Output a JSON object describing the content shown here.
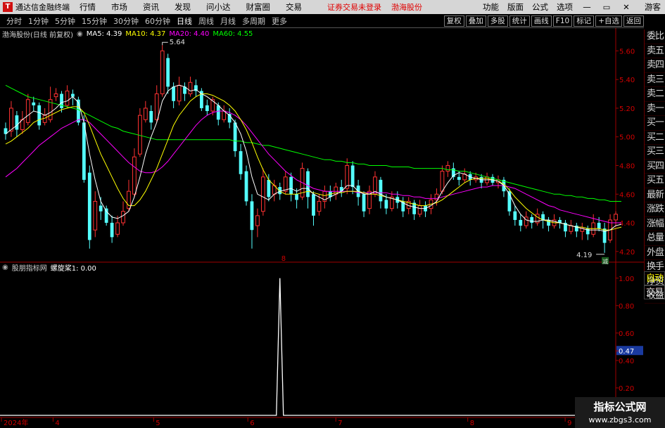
{
  "app": {
    "name": "通达信金融终端",
    "menus": [
      "行情",
      "市场",
      "资讯",
      "发现",
      "问小达",
      "财富圈",
      "交易"
    ],
    "login_status": "证券交易未登录",
    "current_stock": "渤海股份",
    "right_menus": [
      "功能",
      "版面",
      "公式",
      "选项"
    ],
    "user": "游客"
  },
  "toolbar": {
    "periods": [
      "分时",
      "1分钟",
      "5分钟",
      "15分钟",
      "30分钟",
      "60分钟",
      "日线",
      "周线",
      "月线",
      "多周期",
      "更多"
    ],
    "active_period": "日线",
    "tools": [
      "复权",
      "叠加",
      "多股",
      "统计",
      "画线",
      "F10",
      "标记",
      "+自选",
      "返回"
    ]
  },
  "chart_header": {
    "stock_label": "渤海股份(日线 前复权)",
    "ma5": "MA5: 4.39",
    "ma10": "MA10: 4.37",
    "ma20": "MA20: 4.40",
    "ma60": "MA60: 4.55"
  },
  "indicator_header": {
    "name": "股朋指标网",
    "value_label": "螺旋桨1: 0.00"
  },
  "sidebar": {
    "items": [
      "委比",
      "卖五",
      "卖四",
      "卖三",
      "卖二",
      "卖一",
      "买一",
      "买二",
      "买三",
      "买四",
      "买五",
      "最新",
      "涨跌",
      "涨幅",
      "总量",
      "外盘",
      "换手",
      "净资",
      "收益"
    ],
    "bottom_items": [
      "自动",
      "交易"
    ]
  },
  "annotations": {
    "high_label": "5.64",
    "low_label": "4.19",
    "mid_marker": "8",
    "small_badge": "减"
  },
  "price_axis": [
    "5.60",
    "5.40",
    "5.20",
    "5.00",
    "4.80",
    "4.60",
    "4.40",
    "4.20"
  ],
  "indicator_axis": [
    "1.00",
    "0.80",
    "0.60",
    "0.47",
    "0.40",
    "0.20"
  ],
  "date_axis": [
    "2024年",
    "4",
    "5",
    "6",
    "7",
    "8",
    "9"
  ],
  "watermark": {
    "title": "指标公式网",
    "url": "www.zbgs3.com"
  },
  "colors": {
    "up": "#54ffff",
    "down": "#ff3232",
    "ma5": "#ffffff",
    "ma10": "#ffff00",
    "ma20": "#ff00ff",
    "ma60": "#00ff00",
    "signal": "#ffffff",
    "axis": "#a00000"
  },
  "chart_data": {
    "type": "candlestick",
    "price_range": [
      4.15,
      5.7
    ],
    "indicator": {
      "name": "螺旋桨1",
      "values_note": "single spike to 1.00",
      "range": [
        0,
        1.05
      ],
      "current_value": 0.47
    },
    "candles": [
      [
        5.06,
        5.02,
        5.1,
        4.98
      ],
      [
        5.04,
        5.2,
        5.25,
        5.0
      ],
      [
        5.15,
        5.05,
        5.18,
        5.0
      ],
      [
        5.05,
        5.12,
        5.18,
        5.02
      ],
      [
        5.1,
        5.26,
        5.3,
        5.08
      ],
      [
        5.24,
        5.22,
        5.28,
        5.18
      ],
      [
        5.22,
        5.08,
        5.24,
        5.05
      ],
      [
        5.1,
        5.15,
        5.2,
        5.08
      ],
      [
        5.12,
        5.26,
        5.35,
        5.1
      ],
      [
        5.28,
        5.3,
        5.34,
        5.25
      ],
      [
        5.3,
        5.2,
        5.32,
        5.17
      ],
      [
        5.22,
        5.32,
        5.36,
        5.2
      ],
      [
        5.3,
        5.28,
        5.33,
        5.22
      ],
      [
        5.26,
        5.1,
        5.28,
        5.08
      ],
      [
        5.1,
        4.7,
        5.15,
        4.68
      ],
      [
        4.75,
        4.28,
        4.8,
        4.22
      ],
      [
        4.35,
        4.55,
        4.62,
        4.3
      ],
      [
        4.52,
        4.48,
        4.58,
        4.42
      ],
      [
        4.5,
        4.4,
        4.52,
        4.38
      ],
      [
        4.4,
        4.3,
        4.45,
        4.26
      ],
      [
        4.32,
        4.4,
        4.45,
        4.3
      ],
      [
        4.4,
        4.48,
        4.55,
        4.38
      ],
      [
        4.5,
        4.62,
        4.7,
        4.48
      ],
      [
        4.6,
        4.86,
        4.92,
        4.58
      ],
      [
        4.88,
        5.15,
        5.2,
        4.86
      ],
      [
        5.12,
        5.2,
        5.25,
        5.1
      ],
      [
        5.18,
        5.1,
        5.22,
        5.05
      ],
      [
        5.12,
        5.3,
        5.36,
        5.1
      ],
      [
        5.3,
        5.6,
        5.64,
        5.28
      ],
      [
        5.55,
        5.35,
        5.58,
        5.3
      ],
      [
        5.35,
        5.25,
        5.38,
        5.2
      ],
      [
        5.25,
        5.36,
        5.42,
        5.22
      ],
      [
        5.35,
        5.3,
        5.38,
        5.25
      ],
      [
        5.3,
        5.38,
        5.42,
        5.28
      ],
      [
        5.36,
        5.32,
        5.4,
        5.28
      ],
      [
        5.32,
        5.2,
        5.34,
        5.18
      ],
      [
        5.22,
        5.18,
        5.26,
        5.15
      ],
      [
        5.18,
        5.26,
        5.28,
        5.15
      ],
      [
        5.22,
        5.12,
        5.24,
        5.08
      ],
      [
        5.12,
        5.18,
        5.22,
        5.1
      ],
      [
        5.16,
        5.1,
        5.2,
        5.06
      ],
      [
        5.1,
        4.9,
        5.12,
        4.86
      ],
      [
        4.9,
        4.74,
        4.95,
        4.7
      ],
      [
        4.76,
        4.55,
        4.8,
        4.52
      ],
      [
        4.55,
        4.35,
        4.6,
        4.22
      ],
      [
        4.38,
        4.45,
        4.5,
        4.3
      ],
      [
        4.48,
        4.72,
        4.78,
        4.45
      ],
      [
        4.7,
        4.58,
        4.74,
        4.55
      ],
      [
        4.6,
        4.66,
        4.7,
        4.55
      ],
      [
        4.65,
        4.6,
        4.68,
        4.56
      ],
      [
        4.62,
        4.72,
        4.76,
        4.6
      ],
      [
        4.72,
        4.6,
        4.75,
        4.55
      ],
      [
        4.6,
        4.56,
        4.64,
        4.5
      ],
      [
        4.58,
        4.78,
        4.82,
        4.56
      ],
      [
        4.76,
        4.58,
        4.78,
        4.5
      ],
      [
        4.6,
        4.45,
        4.62,
        4.38
      ],
      [
        4.48,
        4.55,
        4.6,
        4.45
      ],
      [
        4.55,
        4.62,
        4.66,
        4.5
      ],
      [
        4.62,
        4.58,
        4.66,
        4.55
      ],
      [
        4.6,
        4.65,
        4.68,
        4.56
      ],
      [
        4.65,
        4.62,
        4.7,
        4.58
      ],
      [
        4.64,
        4.8,
        4.85,
        4.6
      ],
      [
        4.8,
        4.65,
        4.83,
        4.6
      ],
      [
        4.66,
        4.58,
        4.7,
        4.52
      ],
      [
        4.6,
        4.48,
        4.62,
        4.44
      ],
      [
        4.5,
        4.62,
        4.66,
        4.46
      ],
      [
        4.6,
        4.72,
        4.76,
        4.58
      ],
      [
        4.7,
        4.55,
        4.72,
        4.5
      ],
      [
        4.56,
        4.5,
        4.6,
        4.46
      ],
      [
        4.5,
        4.58,
        4.62,
        4.48
      ],
      [
        4.58,
        4.54,
        4.62,
        4.5
      ],
      [
        4.55,
        4.48,
        4.58,
        4.44
      ],
      [
        4.5,
        4.55,
        4.58,
        4.46
      ],
      [
        4.54,
        4.46,
        4.56,
        4.42
      ],
      [
        4.46,
        4.52,
        4.56,
        4.44
      ],
      [
        4.52,
        4.48,
        4.55,
        4.44
      ],
      [
        4.5,
        4.56,
        4.6,
        4.46
      ],
      [
        4.56,
        4.6,
        4.64,
        4.52
      ],
      [
        4.62,
        4.76,
        4.8,
        4.6
      ],
      [
        4.76,
        4.8,
        4.83,
        4.72
      ],
      [
        4.78,
        4.72,
        4.82,
        4.7
      ],
      [
        4.72,
        4.7,
        4.76,
        4.66
      ],
      [
        4.7,
        4.74,
        4.78,
        4.68
      ],
      [
        4.74,
        4.7,
        4.76,
        4.66
      ],
      [
        4.7,
        4.72,
        4.75,
        4.68
      ],
      [
        4.72,
        4.68,
        4.74,
        4.64
      ],
      [
        4.68,
        4.72,
        4.75,
        4.66
      ],
      [
        4.72,
        4.68,
        4.74,
        4.66
      ],
      [
        4.68,
        4.7,
        4.73,
        4.64
      ],
      [
        4.7,
        4.62,
        4.72,
        4.58
      ],
      [
        4.62,
        4.48,
        4.64,
        4.45
      ],
      [
        4.48,
        4.42,
        4.52,
        4.38
      ],
      [
        4.42,
        4.38,
        4.46,
        4.34
      ],
      [
        4.38,
        4.44,
        4.48,
        4.36
      ],
      [
        4.44,
        4.4,
        4.46,
        4.36
      ],
      [
        4.4,
        4.46,
        4.5,
        4.38
      ],
      [
        4.46,
        4.42,
        4.48,
        4.36
      ],
      [
        4.42,
        4.38,
        4.44,
        4.34
      ],
      [
        4.38,
        4.42,
        4.46,
        4.36
      ],
      [
        4.42,
        4.4,
        4.44,
        4.36
      ],
      [
        4.4,
        4.34,
        4.42,
        4.3
      ],
      [
        4.34,
        4.38,
        4.42,
        4.32
      ],
      [
        4.38,
        4.34,
        4.4,
        4.3
      ],
      [
        4.34,
        4.36,
        4.4,
        4.28
      ],
      [
        4.36,
        4.32,
        4.38,
        4.28
      ],
      [
        4.32,
        4.4,
        4.46,
        4.3
      ],
      [
        4.4,
        4.36,
        4.44,
        4.34
      ],
      [
        4.36,
        4.26,
        4.4,
        4.19
      ],
      [
        4.28,
        4.42,
        4.46,
        4.26
      ],
      [
        4.42,
        4.46,
        4.48,
        4.38
      ]
    ],
    "ma5": [
      5.02,
      5.05,
      5.08,
      5.12,
      5.15,
      5.18,
      5.17,
      5.15,
      5.17,
      5.2,
      5.24,
      5.25,
      5.28,
      5.24,
      5.1,
      4.88,
      4.7,
      4.55,
      4.48,
      4.44,
      4.43,
      4.45,
      4.48,
      4.58,
      4.72,
      4.88,
      5.0,
      5.1,
      5.25,
      5.32,
      5.35,
      5.36,
      5.35,
      5.32,
      5.33,
      5.3,
      5.28,
      5.25,
      5.22,
      5.18,
      5.15,
      5.1,
      5.02,
      4.9,
      4.72,
      4.6,
      4.58,
      4.56,
      4.6,
      4.62,
      4.63,
      4.64,
      4.62,
      4.64,
      4.64,
      4.6,
      4.58,
      4.56,
      4.58,
      4.6,
      4.62,
      4.66,
      4.66,
      4.62,
      4.6,
      4.6,
      4.62,
      4.6,
      4.58,
      4.57,
      4.56,
      4.54,
      4.52,
      4.51,
      4.5,
      4.5,
      4.52,
      4.55,
      4.62,
      4.68,
      4.73,
      4.75,
      4.74,
      4.72,
      4.71,
      4.7,
      4.7,
      4.7,
      4.69,
      4.66,
      4.6,
      4.52,
      4.46,
      4.42,
      4.41,
      4.41,
      4.42,
      4.42,
      4.41,
      4.4,
      4.39,
      4.38,
      4.37,
      4.36,
      4.35,
      4.35,
      4.35,
      4.34,
      4.35,
      4.38,
      4.39
    ],
    "ma10": [
      4.95,
      4.97,
      5.0,
      5.03,
      5.06,
      5.1,
      5.12,
      5.13,
      5.15,
      5.17,
      5.19,
      5.2,
      5.21,
      5.21,
      5.17,
      5.08,
      4.98,
      4.88,
      4.8,
      4.72,
      4.64,
      4.57,
      4.52,
      4.52,
      4.56,
      4.62,
      4.7,
      4.78,
      4.88,
      4.98,
      5.08,
      5.15,
      5.2,
      5.25,
      5.28,
      5.3,
      5.3,
      5.29,
      5.27,
      5.25,
      5.22,
      5.18,
      5.12,
      5.05,
      4.96,
      4.86,
      4.77,
      4.7,
      4.66,
      4.62,
      4.6,
      4.6,
      4.6,
      4.61,
      4.62,
      4.61,
      4.6,
      4.59,
      4.6,
      4.61,
      4.61,
      4.62,
      4.62,
      4.62,
      4.61,
      4.6,
      4.6,
      4.59,
      4.58,
      4.57,
      4.56,
      4.55,
      4.54,
      4.53,
      4.52,
      4.52,
      4.53,
      4.54,
      4.56,
      4.59,
      4.62,
      4.65,
      4.68,
      4.7,
      4.71,
      4.71,
      4.71,
      4.7,
      4.69,
      4.67,
      4.63,
      4.58,
      4.54,
      4.5,
      4.47,
      4.44,
      4.42,
      4.41,
      4.4,
      4.4,
      4.39,
      4.38,
      4.37,
      4.37,
      4.36,
      4.36,
      4.36,
      4.35,
      4.35,
      4.36,
      4.37
    ],
    "ma20": [
      4.72,
      4.75,
      4.78,
      4.82,
      4.86,
      4.9,
      4.94,
      4.97,
      5.0,
      5.03,
      5.06,
      5.08,
      5.1,
      5.12,
      5.12,
      5.1,
      5.06,
      5.02,
      4.98,
      4.94,
      4.9,
      4.86,
      4.82,
      4.79,
      4.76,
      4.75,
      4.75,
      4.76,
      4.79,
      4.83,
      4.88,
      4.93,
      4.98,
      5.03,
      5.08,
      5.12,
      5.15,
      5.17,
      5.18,
      5.18,
      5.17,
      5.15,
      5.12,
      5.08,
      5.03,
      4.98,
      4.93,
      4.88,
      4.84,
      4.8,
      4.76,
      4.73,
      4.7,
      4.68,
      4.66,
      4.64,
      4.63,
      4.62,
      4.62,
      4.62,
      4.62,
      4.62,
      4.62,
      4.61,
      4.61,
      4.61,
      4.61,
      4.61,
      4.61,
      4.6,
      4.6,
      4.59,
      4.59,
      4.58,
      4.58,
      4.57,
      4.57,
      4.57,
      4.58,
      4.59,
      4.6,
      4.61,
      4.62,
      4.63,
      4.64,
      4.65,
      4.65,
      4.66,
      4.66,
      4.66,
      4.65,
      4.64,
      4.62,
      4.6,
      4.58,
      4.56,
      4.54,
      4.52,
      4.51,
      4.49,
      4.48,
      4.47,
      4.46,
      4.45,
      4.44,
      4.43,
      4.42,
      4.41,
      4.4,
      4.4,
      4.4
    ],
    "ma60": [
      5.36,
      5.34,
      5.32,
      5.3,
      5.28,
      5.27,
      5.26,
      5.25,
      5.24,
      5.23,
      5.22,
      5.21,
      5.2,
      5.19,
      5.17,
      5.15,
      5.13,
      5.11,
      5.09,
      5.07,
      5.06,
      5.04,
      5.03,
      5.02,
      5.01,
      5.0,
      4.99,
      4.98,
      4.98,
      4.98,
      4.98,
      4.98,
      4.98,
      4.98,
      4.98,
      4.98,
      4.98,
      4.98,
      4.98,
      4.98,
      4.98,
      4.97,
      4.97,
      4.96,
      4.96,
      4.95,
      4.94,
      4.94,
      4.93,
      4.92,
      4.91,
      4.9,
      4.89,
      4.88,
      4.87,
      4.86,
      4.85,
      4.84,
      4.84,
      4.83,
      4.83,
      4.82,
      4.82,
      4.81,
      4.81,
      4.8,
      4.8,
      4.8,
      4.8,
      4.79,
      4.79,
      4.79,
      4.79,
      4.78,
      4.78,
      4.78,
      4.78,
      4.78,
      4.78,
      4.77,
      4.77,
      4.76,
      4.76,
      4.75,
      4.74,
      4.73,
      4.72,
      4.71,
      4.7,
      4.69,
      4.68,
      4.67,
      4.66,
      4.65,
      4.64,
      4.63,
      4.62,
      4.61,
      4.6,
      4.6,
      4.59,
      4.59,
      4.58,
      4.58,
      4.57,
      4.57,
      4.56,
      4.56,
      4.55,
      4.55,
      4.55
    ],
    "spike_index": 49
  }
}
